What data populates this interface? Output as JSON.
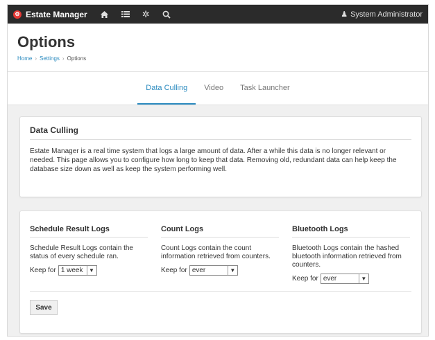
{
  "navbar": {
    "brand": "Estate Manager",
    "icons": [
      "home-icon",
      "list-icon",
      "gear-icon",
      "search-icon"
    ],
    "user": "System Administrator"
  },
  "header": {
    "title": "Options",
    "breadcrumb": [
      "Home",
      "Settings",
      "Options"
    ]
  },
  "tabs": [
    {
      "label": "Data Culling",
      "active": true
    },
    {
      "label": "Video",
      "active": false
    },
    {
      "label": "Task Launcher",
      "active": false
    }
  ],
  "intro": {
    "title": "Data Culling",
    "body": "Estate Manager is a real time system that logs a large amount of data. After a while this data is no longer relevant or needed. This page allows you to configure how long to keep that data. Removing old, redundant data can help keep the database size down as well as keep the system performing well."
  },
  "logs": [
    {
      "title": "Schedule Result Logs",
      "desc": "Schedule Result Logs contain the status of every schedule ran.",
      "keep_label": "Keep for",
      "value": "1 week"
    },
    {
      "title": "Count Logs",
      "desc": "Count Logs contain the count information retrieved from counters.",
      "keep_label": "Keep for",
      "value": "ever"
    },
    {
      "title": "Bluetooth Logs",
      "desc": "Bluetooth Logs contain the hashed bluetooth information retrieved from counters.",
      "keep_label": "Keep for",
      "value": "ever"
    }
  ],
  "save_label": "Save",
  "colors": {
    "navbar": "#2b2b2b",
    "accent": "#2a8abf",
    "brand_logo": "#e53935"
  }
}
